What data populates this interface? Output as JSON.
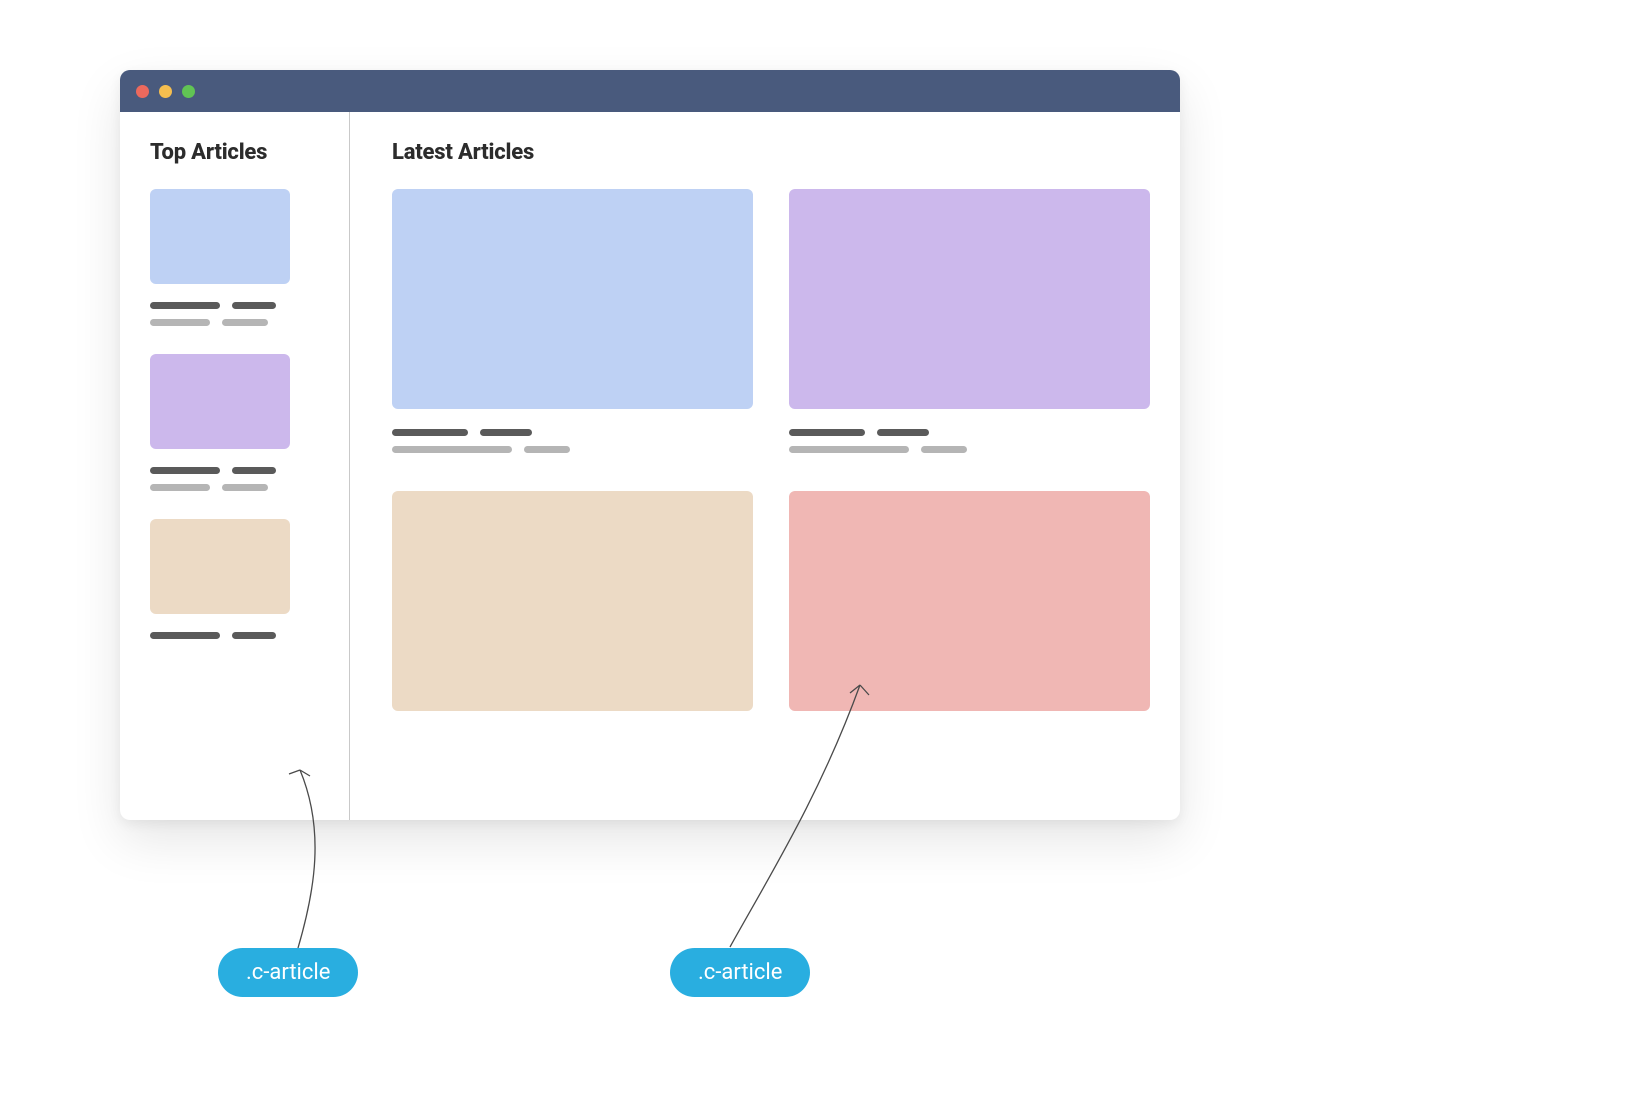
{
  "sidebar": {
    "title": "Top Articles"
  },
  "main": {
    "title": "Latest Articles"
  },
  "annotations": {
    "left_label": ".c-article",
    "right_label": ".c-article"
  }
}
